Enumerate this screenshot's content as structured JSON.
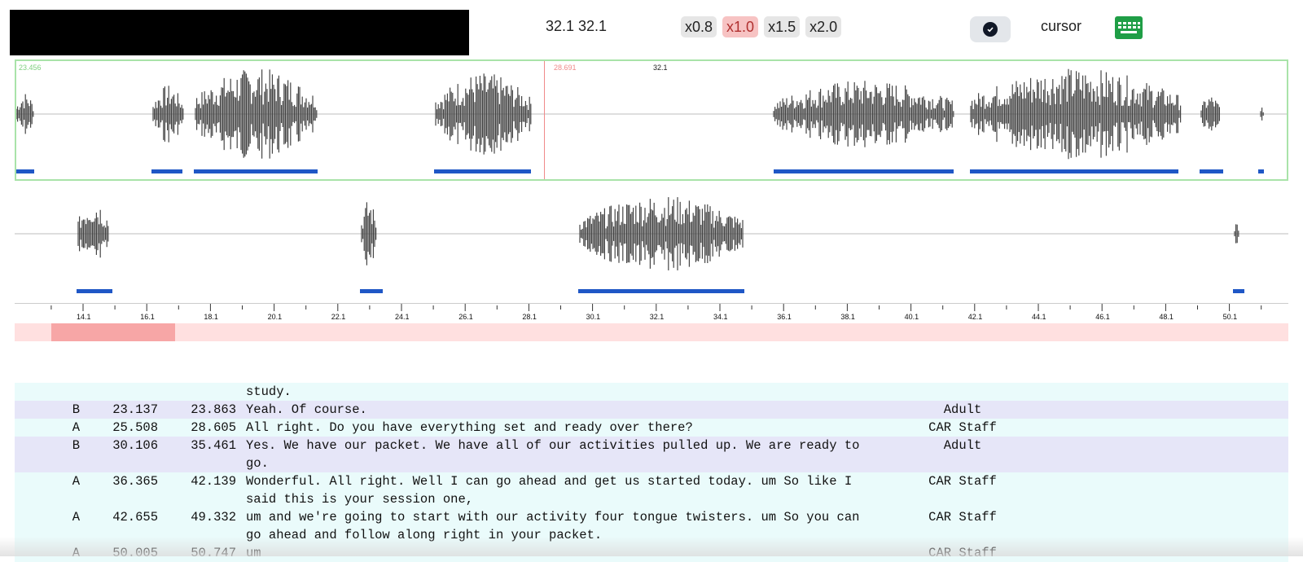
{
  "header": {
    "time_pair": "32.1 32.1",
    "speeds": [
      "x0.8",
      "x1.0",
      "x1.5",
      "x2.0"
    ],
    "active_speed": "x1.0",
    "mode_label": "cursor",
    "check_icon": "check-circle-icon",
    "keyboard_icon": "keyboard-icon"
  },
  "waveform": {
    "view_start_label": "23.456",
    "marker_label": "28.691",
    "cursor_label": "32.1"
  },
  "ruler": {
    "ticks": [
      "14.1",
      "16.1",
      "18.1",
      "20.1",
      "22.1",
      "24.1",
      "26.1",
      "28.1",
      "30.1",
      "32.1",
      "34.1",
      "36.1",
      "38.1",
      "40.1",
      "42.1",
      "44.1",
      "46.1",
      "48.1",
      "50.1"
    ]
  },
  "colors": {
    "segment_blue": "#1f57c6",
    "view_border_green": "#a9e3a9",
    "marker_red": "#f08a8a",
    "scroll_track": "#ffe0e0",
    "scroll_thumb": "#f7a6a6",
    "row_a_bg": "#eafbfb",
    "row_b_bg": "#e6e6f8"
  },
  "transcript": {
    "rows": [
      {
        "speaker": "",
        "start": "",
        "end": "",
        "text": "study.",
        "role": ""
      },
      {
        "speaker": "B",
        "start": "23.137",
        "end": "23.863",
        "text": "Yeah. Of course.",
        "role": "Adult"
      },
      {
        "speaker": "A",
        "start": "25.508",
        "end": "28.605",
        "text": "All right. Do you have everything set and ready over there?",
        "role": "CAR Staff"
      },
      {
        "speaker": "B",
        "start": "30.106",
        "end": "35.461",
        "text": "Yes. We have our packet. We have all of our activities pulled up. We are ready to\ngo.",
        "role": "Adult"
      },
      {
        "speaker": "A",
        "start": "36.365",
        "end": "42.139",
        "text": "Wonderful. All right. Well I can go ahead and get us started today. um So like I\nsaid this is your session one,",
        "role": "CAR Staff"
      },
      {
        "speaker": "A",
        "start": "42.655",
        "end": "49.332",
        "text": "um and we're going to start with our activity four tongue twisters. um So you can\ngo ahead and follow along right in your packet.",
        "role": "CAR Staff"
      },
      {
        "speaker": "A",
        "start": "50.005",
        "end": "50.747",
        "text": "um",
        "role": "CAR Staff"
      }
    ]
  }
}
